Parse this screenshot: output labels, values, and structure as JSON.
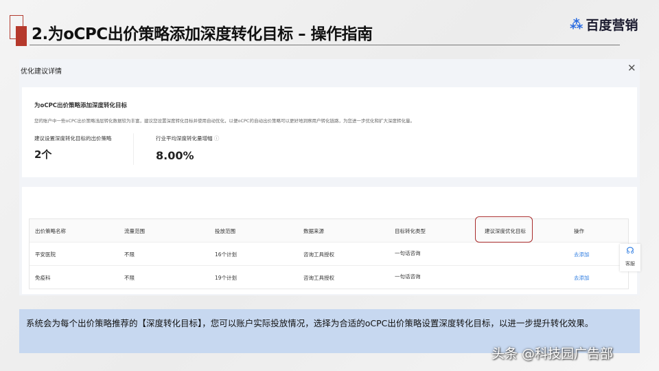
{
  "slide": {
    "title": "2.为oCPC出价策略添加深度转化目标 – 操作指南",
    "logo": "百度营销"
  },
  "dialog": {
    "title": "优化建议详情",
    "close": "✕",
    "card": {
      "heading": "为oCPC出价策略添加深度转化目标",
      "desc": "您的账户中一些oCPC出价策略浅层转化数据较为丰富，建议您设置深度转化目标并使用自动优化，以便oCPC的自动出价策略可以更好地洞察用户转化链路，为您进一步优化和扩大深度转化量。",
      "stat1_label": "建议设置深度转化目标的出价策略",
      "stat1_value": "2个",
      "stat2_label": "行业平均深度转化量增幅",
      "stat2_value": "8.00%"
    },
    "table": {
      "headers": [
        "出价策略名称",
        "流量范围",
        "投放范围",
        "数据来源",
        "目标转化类型",
        "建议深度优化目标",
        "操作"
      ],
      "rows": [
        [
          "平安医院",
          "不限",
          "16个计划",
          "咨询工具授权",
          "一句话咨询",
          "",
          "去添加"
        ],
        [
          "免疫科",
          "不限",
          "19个计划",
          "咨询工具授权",
          "一句话咨询",
          "",
          "去添加"
        ]
      ]
    },
    "support": "客服"
  },
  "note": "系统会为每个出价策略推荐的【深度转化目标】，您可以账户实际投放情况，选择为合适的oCPC出价策略设置深度转化目标，以进一步提升转化效果。",
  "watermark": "头条 @科技园广告部"
}
